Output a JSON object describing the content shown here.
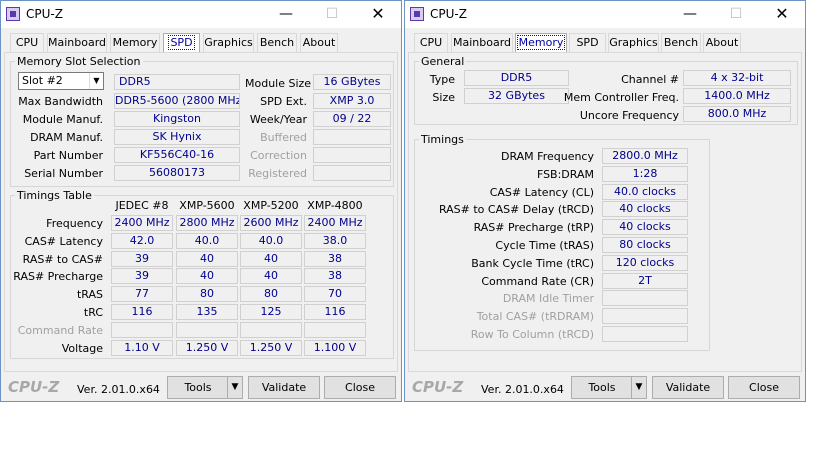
{
  "left": {
    "title": "CPU-Z",
    "tabs": [
      "CPU",
      "Mainboard",
      "Memory",
      "SPD",
      "Graphics",
      "Bench",
      "About"
    ],
    "active_tab": "SPD",
    "slot_group": "Memory Slot Selection",
    "slot_select": "Slot #2",
    "type": "DDR5",
    "module_size_label": "Module Size",
    "module_size": "16 GBytes",
    "max_bw_label": "Max Bandwidth",
    "max_bw": "DDR5-5600 (2800 MHz)",
    "spd_ext_label": "SPD Ext.",
    "spd_ext": "XMP 3.0",
    "manuf_label": "Module Manuf.",
    "manuf": "Kingston",
    "week_label": "Week/Year",
    "week": "09 / 22",
    "dram_manuf_label": "DRAM Manuf.",
    "dram_manuf": "SK Hynix",
    "buffered": "Buffered",
    "part_label": "Part Number",
    "part": "KF556C40-16",
    "correction": "Correction",
    "serial_label": "Serial Number",
    "serial": "56080173",
    "registered": "Registered",
    "timings_group": "Timings Table",
    "cols": [
      "JEDEC #8",
      "XMP-5600",
      "XMP-5200",
      "XMP-4800"
    ],
    "rows": [
      {
        "label": "Frequency",
        "vals": [
          "2400 MHz",
          "2800 MHz",
          "2600 MHz",
          "2400 MHz"
        ],
        "dim": false
      },
      {
        "label": "CAS# Latency",
        "vals": [
          "42.0",
          "40.0",
          "40.0",
          "38.0"
        ],
        "dim": false
      },
      {
        "label": "RAS# to CAS#",
        "vals": [
          "39",
          "40",
          "40",
          "38"
        ],
        "dim": false
      },
      {
        "label": "RAS# Precharge",
        "vals": [
          "39",
          "40",
          "40",
          "38"
        ],
        "dim": false
      },
      {
        "label": "tRAS",
        "vals": [
          "77",
          "80",
          "80",
          "70"
        ],
        "dim": false
      },
      {
        "label": "tRC",
        "vals": [
          "116",
          "135",
          "125",
          "116"
        ],
        "dim": false
      },
      {
        "label": "Command Rate",
        "vals": [
          "",
          "",
          "",
          ""
        ],
        "dim": true
      },
      {
        "label": "Voltage",
        "vals": [
          "1.10 V",
          "1.250 V",
          "1.250 V",
          "1.100 V"
        ],
        "dim": false
      }
    ]
  },
  "right": {
    "title": "CPU-Z",
    "tabs": [
      "CPU",
      "Mainboard",
      "Memory",
      "SPD",
      "Graphics",
      "Bench",
      "About"
    ],
    "active_tab": "Memory",
    "general_group": "General",
    "type_label": "Type",
    "type": "DDR5",
    "channel_label": "Channel #",
    "channel": "4 x 32-bit",
    "size_label": "Size",
    "size": "32 GBytes",
    "mcf_label": "Mem Controller Freq.",
    "mcf": "1400.0 MHz",
    "uncore_label": "Uncore Frequency",
    "uncore": "800.0 MHz",
    "timings_group": "Timings",
    "rows": [
      {
        "label": "DRAM Frequency",
        "val": "2800.0 MHz",
        "dim": false
      },
      {
        "label": "FSB:DRAM",
        "val": "1:28",
        "dim": false
      },
      {
        "label": "CAS# Latency (CL)",
        "val": "40.0 clocks",
        "dim": false
      },
      {
        "label": "RAS# to CAS# Delay (tRCD)",
        "val": "40 clocks",
        "dim": false
      },
      {
        "label": "RAS# Precharge (tRP)",
        "val": "40 clocks",
        "dim": false
      },
      {
        "label": "Cycle Time (tRAS)",
        "val": "80 clocks",
        "dim": false
      },
      {
        "label": "Bank Cycle Time (tRC)",
        "val": "120 clocks",
        "dim": false
      },
      {
        "label": "Command Rate (CR)",
        "val": "2T",
        "dim": false
      },
      {
        "label": "DRAM Idle Timer",
        "val": "",
        "dim": true
      },
      {
        "label": "Total CAS# (tRDRAM)",
        "val": "",
        "dim": true
      },
      {
        "label": "Row To Column (tRCD)",
        "val": "",
        "dim": true
      }
    ]
  },
  "footer": {
    "brand": "CPU-Z",
    "version": "Ver. 2.01.0.x64",
    "tools": "Tools",
    "tools_arrow": "▼",
    "validate": "Validate",
    "close": "Close"
  },
  "window_buttons": {
    "min": "—",
    "max": "☐",
    "close": "✕"
  }
}
